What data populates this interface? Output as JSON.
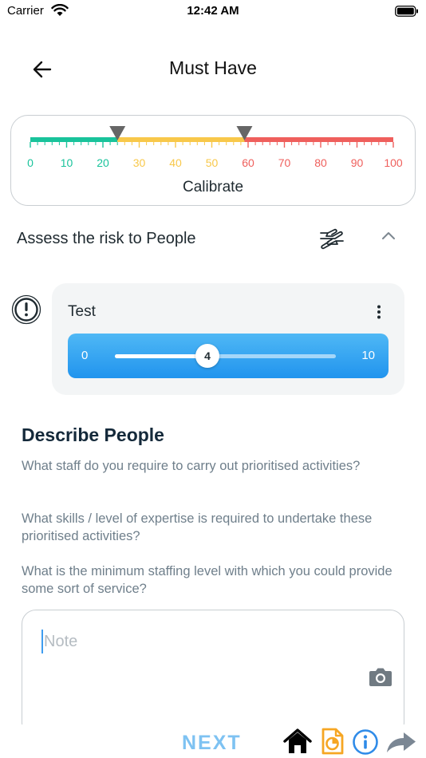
{
  "status_bar": {
    "carrier": "Carrier",
    "time": "12:42 AM",
    "icons": [
      "wifi-icon",
      "battery-icon"
    ]
  },
  "header": {
    "title": "Must Have",
    "back_icon": "arrow-left-icon"
  },
  "calibrate": {
    "label": "Calibrate",
    "scale_min": 0,
    "scale_max": 100,
    "ticks": [
      "0",
      "10",
      "20",
      "30",
      "40",
      "50",
      "60",
      "70",
      "80",
      "90",
      "100"
    ],
    "markers": [
      24,
      59
    ],
    "zones": [
      {
        "from": 0,
        "to": 24,
        "color": "#19c39b"
      },
      {
        "from": 24,
        "to": 59,
        "color": "#f8c84a"
      },
      {
        "from": 59,
        "to": 100,
        "color": "#ef5f5c"
      }
    ],
    "marker_color": "#666666"
  },
  "assess": {
    "label": "Assess the risk to People",
    "icons": [
      "hands-icon",
      "chevron-up-icon"
    ]
  },
  "risk_item": {
    "alert_icon": "exclamation-circle-icon",
    "title": "Test",
    "menu_icon": "kebab-menu-icon",
    "slider": {
      "min": "0",
      "max": "10",
      "value": "4",
      "color_start": "#4fb8f5",
      "color_end": "#2194ee"
    }
  },
  "describe": {
    "title": "Describe People",
    "questions": [
      "What staff do you require to carry out prioritised activities?",
      "What skills / level of expertise is required to undertake these prioritised activities?",
      "What is the minimum staffing level with which you could provide some sort of service?"
    ]
  },
  "note": {
    "value": "",
    "placeholder": "Note",
    "camera_icon": "camera-icon"
  },
  "bottom_bar": {
    "next_label": "NEXT",
    "next_color": "#7ec2f2",
    "icons": [
      "home-icon",
      "report-icon",
      "info-icon",
      "share-icon"
    ],
    "report_color": "#f6a623",
    "info_color": "#2f8be8"
  }
}
